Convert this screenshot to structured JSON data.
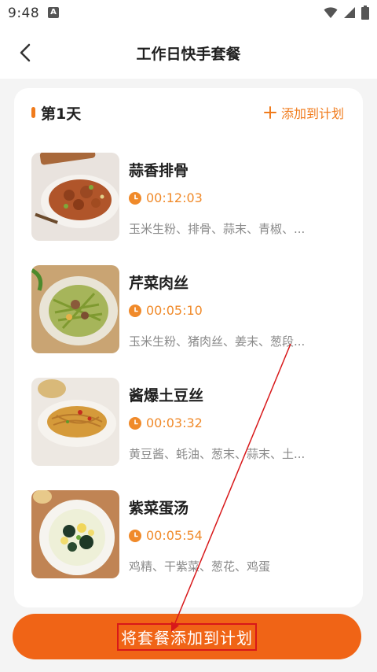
{
  "status_bar": {
    "time": "9:48",
    "notification_icon": "A"
  },
  "nav": {
    "title": "工作日快手套餐"
  },
  "day_section": {
    "title": "第1天",
    "add_to_plan": "添加到计划"
  },
  "dishes": [
    {
      "name": "蒜香排骨",
      "time": "00:12:03",
      "ingredients": "玉米生粉、排骨、蒜末、青椒、..."
    },
    {
      "name": "芹菜肉丝",
      "time": "00:05:10",
      "ingredients": "玉米生粉、猪肉丝、姜末、葱段..."
    },
    {
      "name": "酱爆土豆丝",
      "time": "00:03:32",
      "ingredients": "黄豆酱、蚝油、葱末、蒜末、土..."
    },
    {
      "name": "紫菜蛋汤",
      "time": "00:05:54",
      "ingredients": "鸡精、干紫菜、葱花、鸡蛋"
    }
  ],
  "bottom_button": {
    "label": "将套餐添加到计划"
  },
  "colors": {
    "accent": "#f07b1c",
    "button": "#f06416",
    "annotation": "#d8181a"
  },
  "icons": [
    "wifi-icon",
    "signal-icon",
    "battery-icon",
    "back-arrow-icon",
    "plus-icon",
    "clock-icon"
  ]
}
